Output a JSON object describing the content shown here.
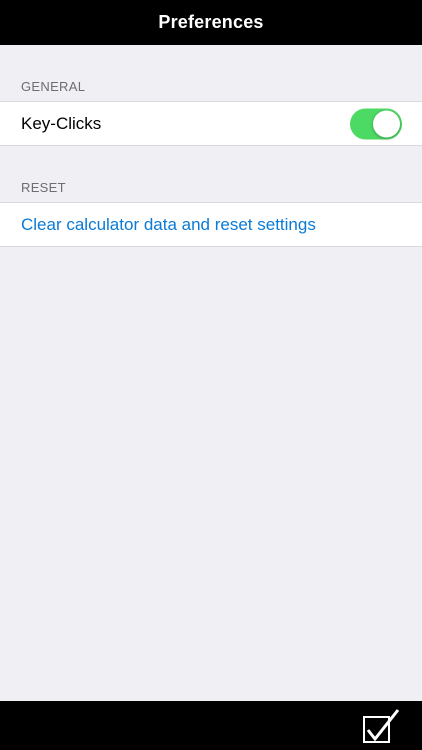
{
  "nav": {
    "title": "Preferences"
  },
  "sections": {
    "general": {
      "header": "GENERAL",
      "key_clicks_label": "Key-Clicks",
      "key_clicks_enabled": true
    },
    "reset": {
      "header": "RESET",
      "reset_link_label": "Clear calculator data and reset settings"
    }
  },
  "toolbar": {
    "done_icon": "checkbox-checkmark-icon"
  },
  "colors": {
    "background": "#efeff4",
    "bar": "#000000",
    "toggle_on": "#4cd964",
    "link": "#0a7ad6",
    "section_header": "#6d6d72"
  }
}
